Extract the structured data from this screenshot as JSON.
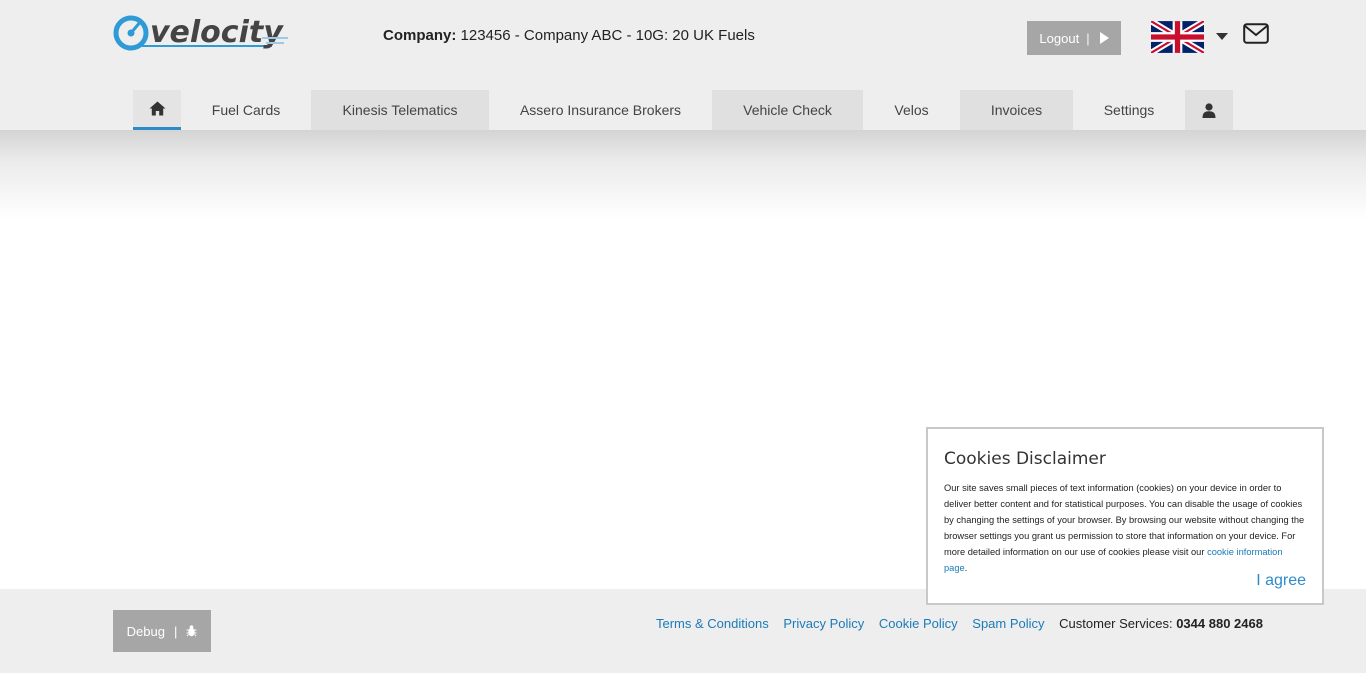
{
  "header": {
    "logo_text": "velocity",
    "company_label": "Company:",
    "company_value": "123456 - Company ABC - 10G: 20 UK Fuels",
    "logout_label": "Logout",
    "logout_separator": "|",
    "language_icon": "uk-flag-icon",
    "mail_icon": "envelope-icon"
  },
  "nav": {
    "home_icon": "home-icon",
    "items": [
      {
        "label": "Fuel Cards"
      },
      {
        "label": "Kinesis Telematics"
      },
      {
        "label": "Assero Insurance Brokers"
      },
      {
        "label": "Vehicle Check"
      },
      {
        "label": "Velos"
      },
      {
        "label": "Invoices"
      },
      {
        "label": "Settings"
      }
    ],
    "user_icon": "user-icon"
  },
  "footer": {
    "debug_label": "Debug",
    "debug_separator": "|",
    "debug_icon": "bug-icon",
    "links": [
      "Terms & Conditions",
      "Privacy Policy",
      "Cookie Policy",
      "Spam Policy"
    ],
    "customer_services_label": "Customer Services:",
    "customer_services_phone": "0344 880 2468"
  },
  "cookie": {
    "title": "Cookies Disclaimer",
    "text": "Our site saves small pieces of text information (cookies) on your device in order to deliver better content and for statistical purposes. You can disable the usage of cookies by changing the settings of your browser. By browsing our website without changing the browser settings you grant us permission to store that information on your device. For more detailed information on our use of cookies please visit our",
    "link_text": "cookie information page",
    "link_suffix": ".",
    "agree_label": "I agree"
  },
  "colors": {
    "accent": "#2e8bc9",
    "link": "#1b7bb8",
    "button_gray": "#a6a6a6",
    "header_bg": "#eeeeee"
  }
}
